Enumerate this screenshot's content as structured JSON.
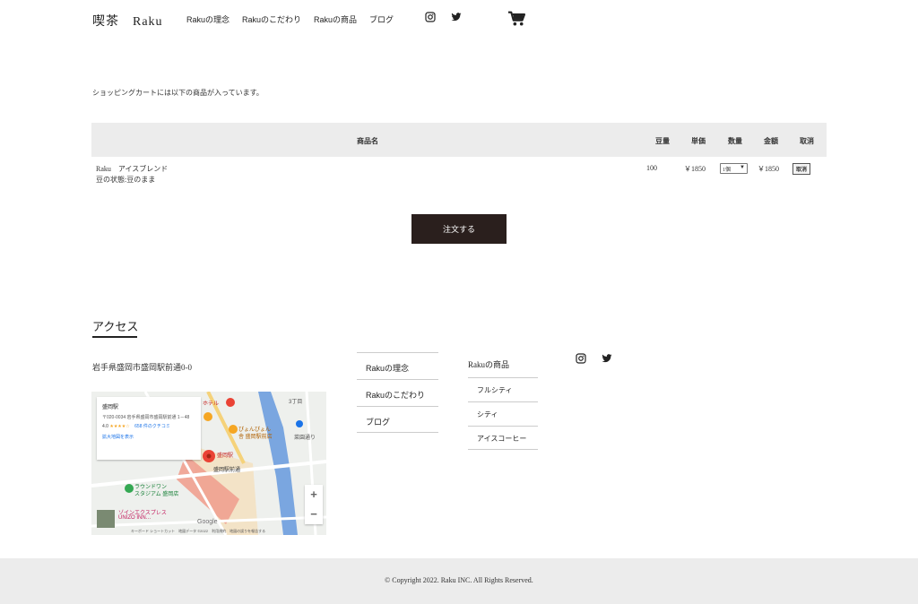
{
  "header": {
    "brand": "喫茶　Raku",
    "nav": [
      "Rakuの理念",
      "Rakuのこだわり",
      "Rakuの商品",
      "ブログ"
    ],
    "icons": [
      "instagram-icon",
      "twitter-icon",
      "cart-icon"
    ]
  },
  "cart": {
    "message": "ショッピングカートには以下の商品が入っています。",
    "columns": {
      "name": "商品名",
      "amount": "豆量",
      "unit_price": "単価",
      "quantity": "数量",
      "total": "金額",
      "cancel": "取消"
    },
    "items": [
      {
        "name": "Raku　アイスブレンド",
        "option": "豆の状態:豆のまま",
        "amount": "100",
        "unit_price": "￥1850",
        "quantity": "1個",
        "total": "￥1850",
        "cancel_label": "取消"
      }
    ],
    "order_button": "注文する"
  },
  "footer": {
    "access_title": "アクセス",
    "address": "岩手県盛岡市盛岡駅前通0-0",
    "map": {
      "place": "盛岡駅",
      "place_address": "〒020-0034 岩手県盛岡市盛岡駅前通 1－48",
      "rating": "4.0",
      "stars": "★★★★☆",
      "reviews": "658 件のクチコミ",
      "expand_link": "拡大地図を表示",
      "labels": {
        "hotel": "ホテル",
        "station": "盛岡駅",
        "station_street": "盛岡駅前通",
        "pyonpyon": "ぴょんぴょん",
        "pyonpyon2": "舎 盛岡駅前店",
        "stadium1": "ラウンドワン",
        "stadium2": "スタジアム 盛岡店",
        "inn1": "ゾインエクスプレス",
        "inn2": "UNIZO INN…",
        "kuruma": "菜園通り",
        "chome": "3丁目",
        "google": "Google",
        "attribution": "キーボード ショートカット　地図データ ©2022　利用規約　地図の誤りを報告する"
      },
      "zoom_in": "+",
      "zoom_out": "−"
    },
    "nav": [
      "Rakuの理念",
      "Rakuのこだわり",
      "ブログ"
    ],
    "products_title": "Rakuの商品",
    "products": [
      "フルシティ",
      "シティ",
      "アイスコーヒー"
    ],
    "icons": [
      "instagram-icon",
      "twitter-icon"
    ],
    "copyright": "© Copyright 2022. Raku INC. All Rights Reserved."
  }
}
